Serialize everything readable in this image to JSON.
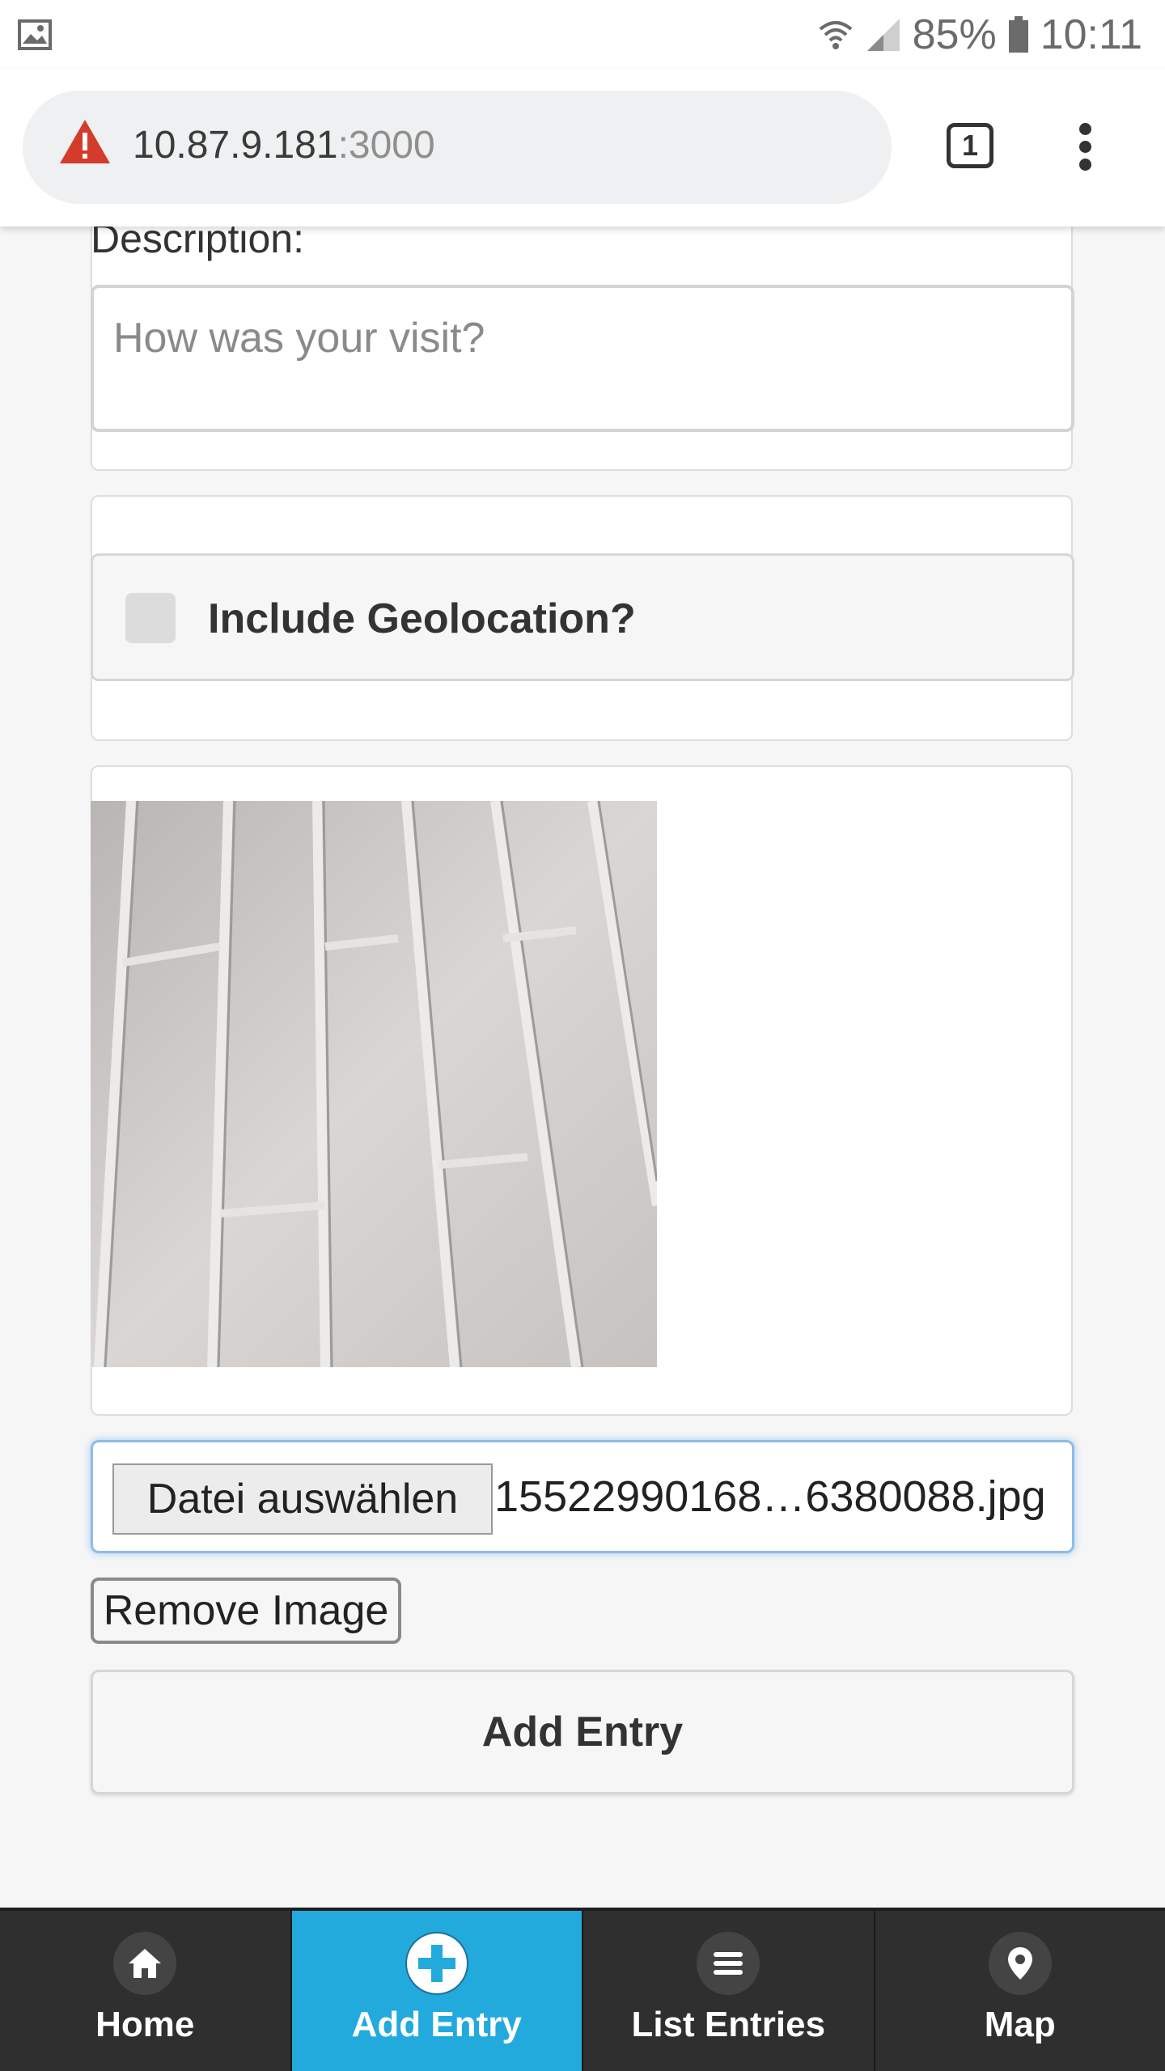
{
  "status_bar": {
    "battery": "85%",
    "time": "10:11"
  },
  "browser": {
    "url_host": "10.87.9.181",
    "url_port": ":3000",
    "tab_count": "1"
  },
  "form": {
    "description_label": "Description:",
    "description_placeholder": "How was your visit?",
    "geolocation_label": "Include Geolocation?",
    "geolocation_checked": false,
    "file_button_label": "Datei auswählen",
    "file_name": "15522990168…6380088.jpg",
    "remove_image_label": "Remove Image",
    "submit_label": "Add Entry"
  },
  "nav": {
    "items": [
      {
        "label": "Home",
        "icon": "home-icon",
        "active": false
      },
      {
        "label": "Add Entry",
        "icon": "plus-icon",
        "active": true
      },
      {
        "label": "List Entries",
        "icon": "list-icon",
        "active": false
      },
      {
        "label": "Map",
        "icon": "map-pin-icon",
        "active": false
      }
    ]
  },
  "colors": {
    "nav_active": "#22aadd",
    "nav_background": "#2f2f2f",
    "focus_outline": "#8fbbe6"
  }
}
